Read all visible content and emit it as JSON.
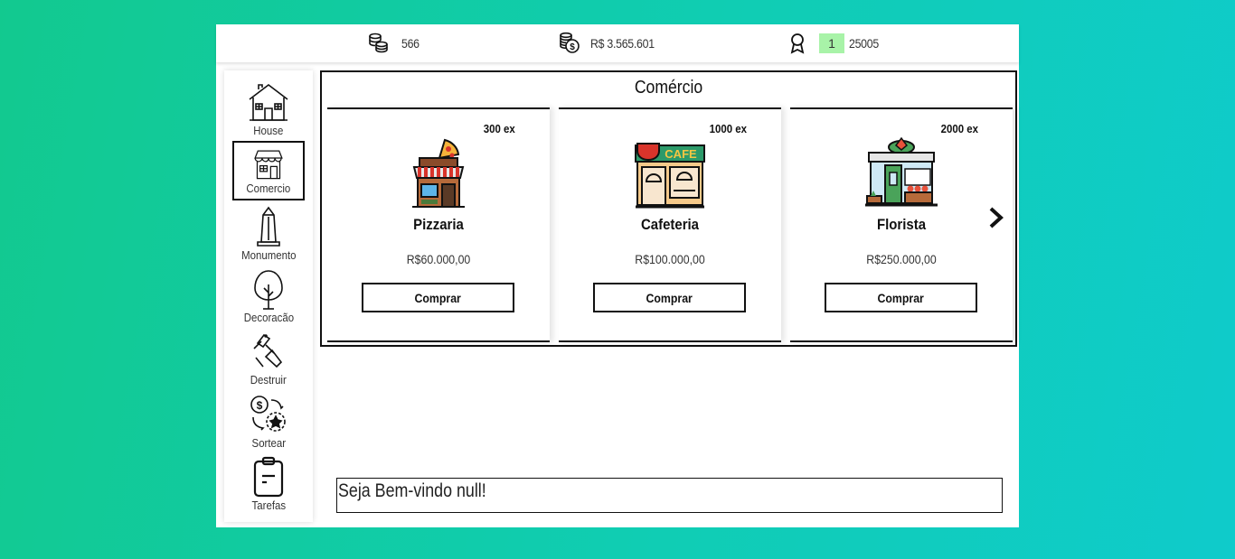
{
  "topbar": {
    "coins": "566",
    "money": "R$ 3.565.601",
    "level": "1",
    "xp": "25005"
  },
  "sidebar": {
    "items": [
      {
        "label": "House",
        "icon": "house-icon"
      },
      {
        "label": "Comercio",
        "icon": "shop-icon",
        "active": true
      },
      {
        "label": "Monumento",
        "icon": "monument-icon"
      },
      {
        "label": "Decoracão",
        "icon": "tree-icon"
      },
      {
        "label": "Destruir",
        "icon": "hammer-icon"
      },
      {
        "label": "Sortear",
        "icon": "lottery-icon"
      },
      {
        "label": "Tarefas",
        "icon": "clipboard-icon"
      }
    ]
  },
  "panel": {
    "title": "Comércio",
    "cards": [
      {
        "name": "Pizzaria",
        "xp": "300 ex",
        "price": "R$60.000,00",
        "button": "Comprar",
        "icon": "pizzaria-icon"
      },
      {
        "name": "Cafeteria",
        "xp": "1000 ex",
        "price": "R$100.000,00",
        "button": "Comprar",
        "icon": "cafe-icon",
        "sign": "CAFE"
      },
      {
        "name": "Florista",
        "xp": "2000 ex",
        "price": "R$250.000,00",
        "button": "Comprar",
        "icon": "florist-icon"
      }
    ],
    "next_icon": "chevron-right-icon"
  },
  "message": "Seja Bem-vindo null!",
  "colors": {
    "background_start": "#12c98f",
    "background_end": "#0fcbcb",
    "level_badge": "#a8f3a8"
  }
}
